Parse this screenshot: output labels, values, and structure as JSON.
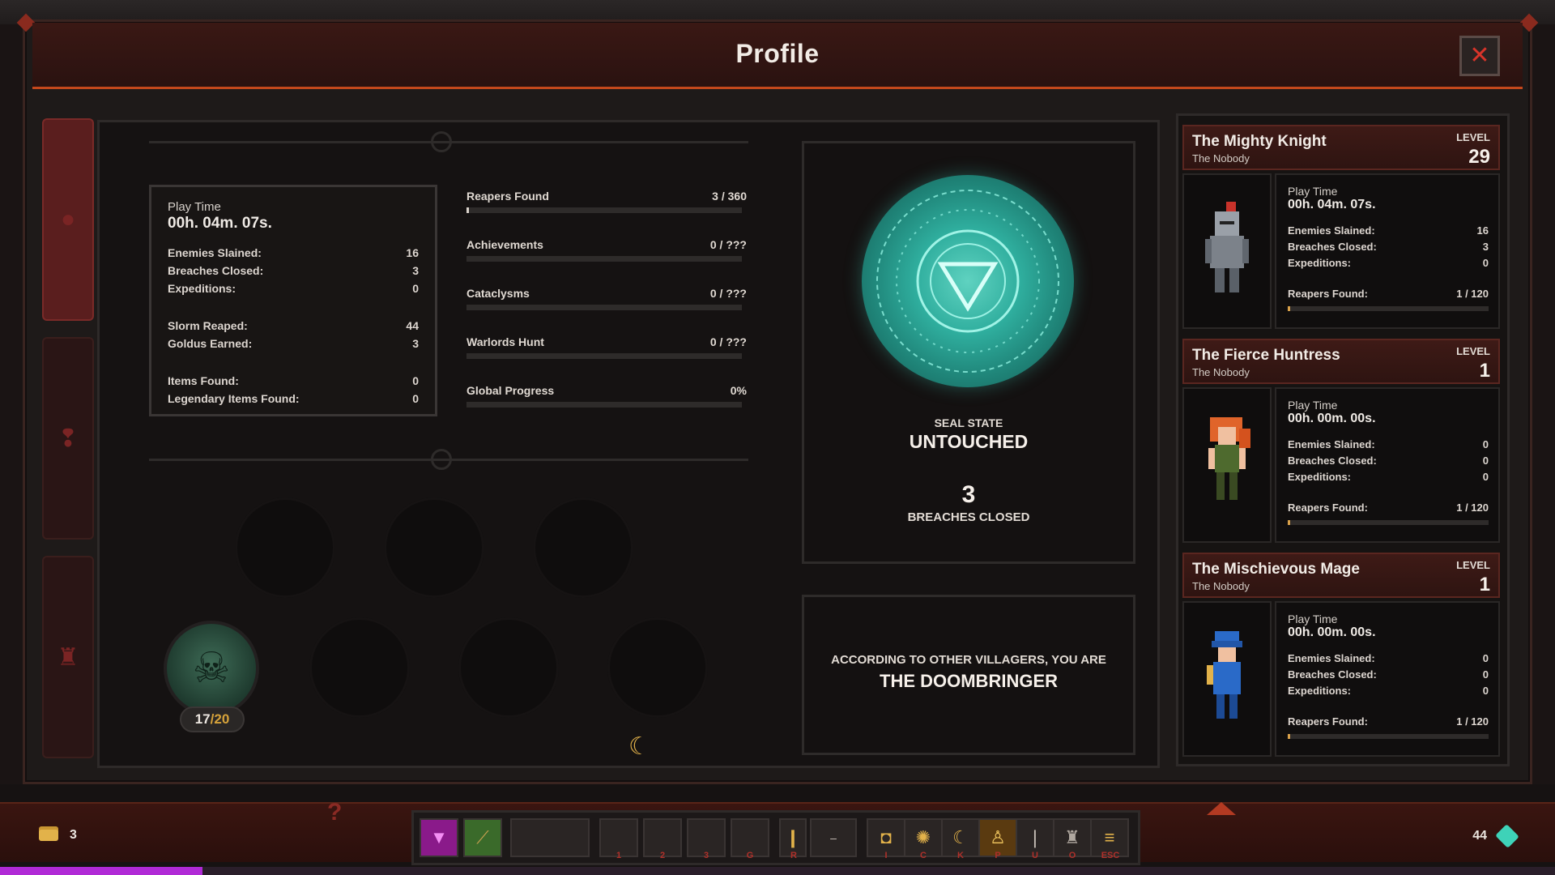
{
  "window": {
    "title": "Profile"
  },
  "profile": {
    "play_time_label": "Play Time",
    "play_time": "00h. 04m. 07s.",
    "stats": [
      {
        "label": "Enemies Slained:",
        "value": "16"
      },
      {
        "label": "Breaches Closed:",
        "value": "3"
      },
      {
        "label": "Expeditions:",
        "value": "0"
      }
    ],
    "currency": [
      {
        "label": "Slorm Reaped:",
        "value": "44"
      },
      {
        "label": "Goldus Earned:",
        "value": "3"
      }
    ],
    "items": [
      {
        "label": "Items Found:",
        "value": "0"
      },
      {
        "label": "Legendary Items Found:",
        "value": "0"
      }
    ]
  },
  "progress": [
    {
      "label": "Reapers Found",
      "value": "3 / 360",
      "fraction": 0.0083
    },
    {
      "label": "Achievements",
      "value": "0 / ???",
      "fraction": 0
    },
    {
      "label": "Cataclysms",
      "value": "0 / ???",
      "fraction": 0
    },
    {
      "label": "Warlords Hunt",
      "value": "0 / ???",
      "fraction": 0
    },
    {
      "label": "Global Progress",
      "value": "0%",
      "fraction": 0
    }
  ],
  "relic": {
    "current": "17",
    "separator": "/",
    "max": "20"
  },
  "seal": {
    "state_label": "SEAL STATE",
    "state_value": "UNTOUCHED",
    "breaches_count": "3",
    "breaches_label": "BREACHES CLOSED",
    "accent_color": "#2fae9e"
  },
  "villagers": {
    "line1": "ACCORDING TO OTHER VILLAGERS, YOU ARE",
    "title": "THE DOOMBRINGER"
  },
  "heroes": [
    {
      "name": "The Mighty Knight",
      "subtitle": "The Nobody",
      "level_label": "LEVEL",
      "level": "29",
      "play_time_label": "Play Time",
      "play_time": "00h. 04m. 07s.",
      "stats": [
        {
          "label": "Enemies Slained:",
          "value": "16"
        },
        {
          "label": "Breaches Closed:",
          "value": "3"
        },
        {
          "label": "Expeditions:",
          "value": "0"
        }
      ],
      "reapers_label": "Reapers Found:",
      "reapers_value": "1 / 120",
      "reapers_fraction": 0.0083,
      "portrait_icon": "knight-icon"
    },
    {
      "name": "The Fierce Huntress",
      "subtitle": "The Nobody",
      "level_label": "LEVEL",
      "level": "1",
      "play_time_label": "Play Time",
      "play_time": "00h. 00m. 00s.",
      "stats": [
        {
          "label": "Enemies Slained:",
          "value": "0"
        },
        {
          "label": "Breaches Closed:",
          "value": "0"
        },
        {
          "label": "Expeditions:",
          "value": "0"
        }
      ],
      "reapers_label": "Reapers Found:",
      "reapers_value": "1 / 120",
      "reapers_fraction": 0.0083,
      "portrait_icon": "huntress-icon"
    },
    {
      "name": "The Mischievous Mage",
      "subtitle": "The Nobody",
      "level_label": "LEVEL",
      "level": "1",
      "play_time_label": "Play Time",
      "play_time": "00h. 00m. 00s.",
      "stats": [
        {
          "label": "Enemies Slained:",
          "value": "0"
        },
        {
          "label": "Breaches Closed:",
          "value": "0"
        },
        {
          "label": "Expeditions:",
          "value": "0"
        }
      ],
      "reapers_label": "Reapers Found:",
      "reapers_value": "1 / 120",
      "reapers_fraction": 0.0083,
      "portrait_icon": "mage-icon"
    }
  ],
  "hud": {
    "gold": "3",
    "slorm": "44",
    "xp_fraction": 0.13,
    "toolbar_keys": [
      "1",
      "2",
      "3",
      "G",
      "R",
      "I",
      "C",
      "K",
      "P",
      "U",
      "O",
      "ESC"
    ],
    "colors": {
      "accent": "#c4481c",
      "xp": "#b02ad6"
    }
  }
}
